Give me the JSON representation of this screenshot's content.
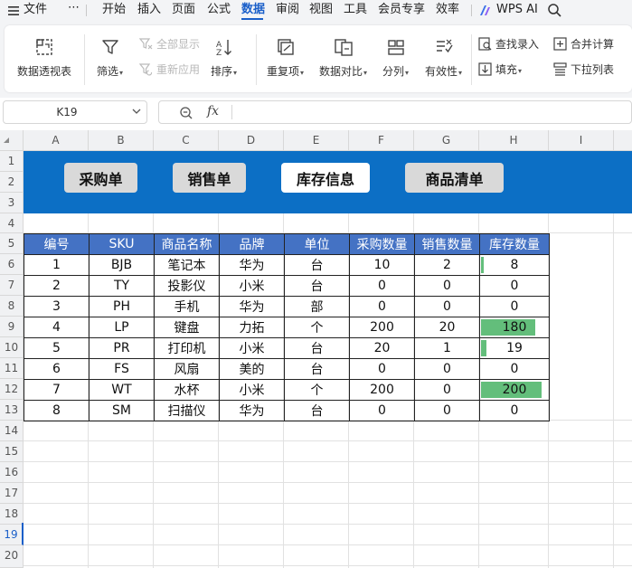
{
  "menu": {
    "file": "文件",
    "more": "⋯",
    "tabs": [
      "开始",
      "插入",
      "页面",
      "公式",
      "数据",
      "审阅",
      "视图",
      "工具",
      "会员专享",
      "效率"
    ],
    "active_tab": "数据",
    "wps_ai": "WPS AI"
  },
  "ribbon": {
    "pivot": "数据透视表",
    "filter": "筛选",
    "show_all": "全部显示",
    "reapply": "重新应用",
    "sort": "排序",
    "duplicates": "重复项",
    "compare": "数据对比",
    "split": "分列",
    "validity": "有效性",
    "find_entry": "查找录入",
    "fill": "填充",
    "merge_calc": "合并计算",
    "dropdown_list": "下拉列表"
  },
  "formula_bar": {
    "cell_ref": "K19",
    "fx": "fx",
    "formula": ""
  },
  "columns": [
    "A",
    "B",
    "C",
    "D",
    "E",
    "F",
    "G",
    "H",
    "I"
  ],
  "rows": [
    "1",
    "2",
    "3",
    "4",
    "5",
    "6",
    "7",
    "8",
    "9",
    "10",
    "11",
    "12",
    "13",
    "14",
    "15",
    "16",
    "17",
    "18",
    "19",
    "20"
  ],
  "selected_row": "19",
  "nav_buttons": [
    "采购单",
    "销售单",
    "库存信息",
    "商品清单"
  ],
  "active_nav": "库存信息",
  "table": {
    "headers": [
      "编号",
      "SKU",
      "商品名称",
      "品牌",
      "单位",
      "采购数量",
      "销售数量",
      "库存数量"
    ],
    "rows": [
      [
        "1",
        "BJB",
        "笔记本",
        "华为",
        "台",
        "10",
        "2",
        "8"
      ],
      [
        "2",
        "TY",
        "投影仪",
        "小米",
        "台",
        "0",
        "0",
        "0"
      ],
      [
        "3",
        "PH",
        "手机",
        "华为",
        "部",
        "0",
        "0",
        "0"
      ],
      [
        "4",
        "LP",
        "键盘",
        "力拓",
        "个",
        "200",
        "20",
        "180"
      ],
      [
        "5",
        "PR",
        "打印机",
        "小米",
        "台",
        "20",
        "1",
        "19"
      ],
      [
        "6",
        "FS",
        "风扇",
        "美的",
        "台",
        "0",
        "0",
        "0"
      ],
      [
        "7",
        "WT",
        "水杯",
        "小米",
        "个",
        "200",
        "0",
        "200"
      ],
      [
        "8",
        "SM",
        "扫描仪",
        "华为",
        "台",
        "0",
        "0",
        "0"
      ]
    ],
    "databar_max": 200
  },
  "colors": {
    "banner": "#0c6fc5",
    "header_fill": "#4472c4",
    "databar": "#63be7b",
    "accent": "#1a5fc9"
  }
}
